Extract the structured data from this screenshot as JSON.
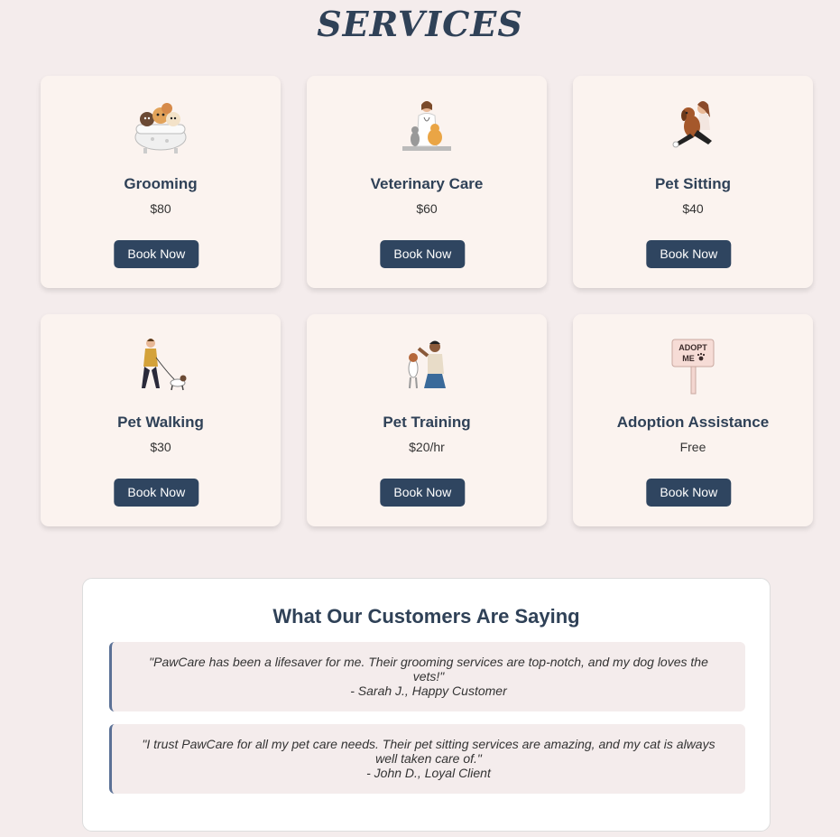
{
  "page": {
    "title": "SERVICES"
  },
  "services": [
    {
      "name": "Grooming",
      "price": "$80",
      "button": "Book Now",
      "icon": "dogs-in-bathtub-illustration"
    },
    {
      "name": "Veterinary Care",
      "price": "$60",
      "button": "Book Now",
      "icon": "veterinarian-with-pets-illustration"
    },
    {
      "name": "Pet Sitting",
      "price": "$40",
      "button": "Book Now",
      "icon": "person-hugging-dog-illustration"
    },
    {
      "name": "Pet Walking",
      "price": "$30",
      "button": "Book Now",
      "icon": "person-walking-dog-illustration"
    },
    {
      "name": "Pet Training",
      "price": "$20/hr",
      "button": "Book Now",
      "icon": "person-training-dog-illustration"
    },
    {
      "name": "Adoption Assistance",
      "price": "Free",
      "button": "Book Now",
      "icon": "adopt-me-sign-illustration"
    }
  ],
  "testimonials": {
    "heading": "What Our Customers Are Saying",
    "items": [
      {
        "quote": "\"PawCare has been a lifesaver for me. Their grooming services are top-notch, and my dog loves the vets!\"",
        "author": "- Sarah J., Happy Customer"
      },
      {
        "quote": "\"I trust PawCare for all my pet care needs. Their pet sitting services are amazing, and my cat is always well taken care of.\"",
        "author": "- John D., Loyal Client"
      }
    ]
  },
  "colors": {
    "background": "#f4ecec",
    "card": "#fbf3ef",
    "accent": "#2f4560",
    "quote_border": "#5b7196"
  }
}
